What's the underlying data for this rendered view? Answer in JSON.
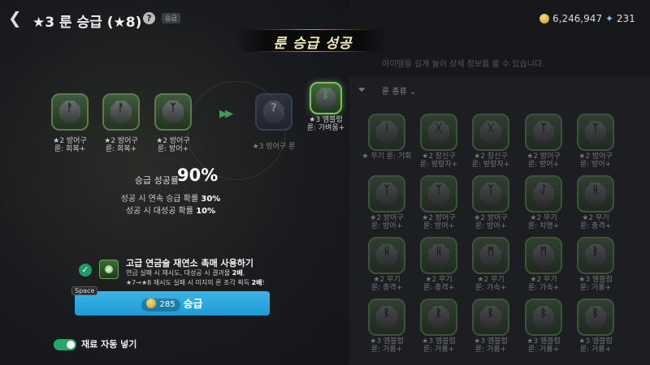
{
  "header": {
    "back_icon": "chevron-left-icon",
    "title": "★3 룬 승급 (★8)",
    "help_icon": "question-icon",
    "tag": "승급",
    "gold": "6,246,947",
    "gem": "231"
  },
  "banner": {
    "text": "룬 승급 성공"
  },
  "inventory": {
    "hint": "아이템을 길게 눌러 상세 정보를 볼 수 있습니다.",
    "sort_label": "룬 종류",
    "cells": [
      {
        "glyph": "ᛁ",
        "l1": "★ 무기 룬: 기회",
        "l2": ""
      },
      {
        "glyph": "ᚷ",
        "l1": "★2 장신구",
        "l2": "룬: 방랑자+"
      },
      {
        "glyph": "ᚷ",
        "l1": "★2 장신구",
        "l2": "룬: 방랑자+"
      },
      {
        "glyph": "ᛉ",
        "l1": "★2 방어구",
        "l2": "룬: 방어+"
      },
      {
        "glyph": "ᛉ",
        "l1": "★2 방어구",
        "l2": "룬: 방어+"
      },
      {
        "glyph": "ᛉ",
        "l1": "★2 방어구",
        "l2": "룬: 방어+"
      },
      {
        "glyph": "ᛉ",
        "l1": "★2 방어구",
        "l2": "룬: 방어+"
      },
      {
        "glyph": "ᛉ",
        "l1": "★2 방어구",
        "l2": "룬: 방어+"
      },
      {
        "glyph": "ᛇ",
        "l1": "★2 무기",
        "l2": "룬: 치명+"
      },
      {
        "glyph": "ᚺ",
        "l1": "★2 무기",
        "l2": "룬: 충격+"
      },
      {
        "glyph": "ᚺ",
        "l1": "★2 무기",
        "l2": "룬: 충격+"
      },
      {
        "glyph": "ᚺ",
        "l1": "★2 무기",
        "l2": "룬: 충격+"
      },
      {
        "glyph": "ᛗ",
        "l1": "★2 무기",
        "l2": "룬: 가속+"
      },
      {
        "glyph": "ᛗ",
        "l1": "★2 무기",
        "l2": "룬: 가속+"
      },
      {
        "glyph": "ᛒ",
        "l1": "★3 엠블럼",
        "l2": "룬: 거룡+"
      },
      {
        "glyph": "ᛒ",
        "l1": "★3 엠블럼",
        "l2": "룬: 거룡+"
      },
      {
        "glyph": "ᛒ",
        "l1": "★3 엠블럼",
        "l2": "룬: 거룡+"
      },
      {
        "glyph": "ᛒ",
        "l1": "★3 엠블럼",
        "l2": "룬: 거룡+"
      },
      {
        "glyph": "ᛒ",
        "l1": "★3 엠블럼",
        "l2": "룬: 거룡+"
      },
      {
        "glyph": "ᛒ",
        "l1": "★3 엠블럼",
        "l2": "룬: 거룡+"
      }
    ]
  },
  "materials": [
    {
      "glyph": "ᚨ",
      "l1": "★2 방어구",
      "l2": "룬: 회복+"
    },
    {
      "glyph": "ᚨ",
      "l1": "★2 방어구",
      "l2": "룬: 회복+"
    },
    {
      "glyph": "ᛉ",
      "l1": "★2 방어구",
      "l2": "룬: 방어+"
    }
  ],
  "preview": {
    "glyph": "?",
    "l1": "★3 방어구 룬"
  },
  "result": {
    "glyph": "ᛒ",
    "l1": "★3 엠블럼",
    "l2": "룬: 가벼움+"
  },
  "rate": {
    "label": "승급 성공률",
    "value": "90%",
    "line1_pre": "성공 시 연속 승급 확률 ",
    "line1_val": "30%",
    "line2_pre": "성공 시 대성공 확률 ",
    "line2_val": "10%"
  },
  "option": {
    "title": "고급 연금술 재연소 촉매 사용하기",
    "d1_pre": "연금 실패 시 재시도, 대성공 시 결과물 ",
    "d1_val": "2배",
    "d1_post": ",",
    "d2_pre": "★7→★8 재시도 실패 시 미지의 룬 조각 획득 ",
    "d2_val": "2배",
    "d2_post": "!"
  },
  "upgrade": {
    "key_hint": "Space",
    "cost": "285",
    "label": "승급"
  },
  "auto": {
    "label": "재료 자동 넣기"
  }
}
